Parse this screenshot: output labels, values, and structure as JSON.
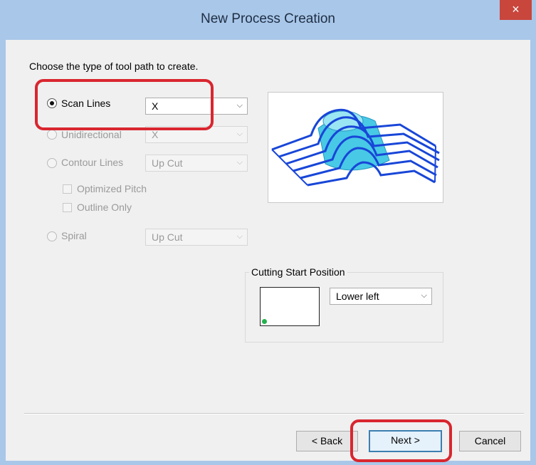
{
  "window": {
    "title": "New Process Creation",
    "close_glyph": "×"
  },
  "instruction": "Choose the type of tool path to create.",
  "options": {
    "scan_lines": {
      "label": "Scan Lines",
      "selected": true,
      "combo_value": "X"
    },
    "unidirectional": {
      "label": "Unidirectional",
      "selected": false,
      "combo_value": "X"
    },
    "contour_lines": {
      "label": "Contour Lines",
      "selected": false,
      "combo_value": "Up Cut"
    },
    "optimized_pitch": {
      "label": "Optimized Pitch",
      "checked": false
    },
    "outline_only": {
      "label": "Outline Only",
      "checked": false
    },
    "spiral": {
      "label": "Spiral",
      "selected": false,
      "combo_value": "Up Cut"
    }
  },
  "cutting_start": {
    "group_label": "Cutting Start Position",
    "combo_value": "Lower left"
  },
  "buttons": {
    "back": "< Back",
    "next": "Next >",
    "cancel": "Cancel"
  },
  "colors": {
    "accent": "#3c7fb1",
    "highlight": "#d9262f",
    "toolpath": "#1846d8",
    "surface": "#48c9e6",
    "start_dot": "#22b14c"
  },
  "icons": {
    "dropdown": "chevron-down-icon",
    "close": "close-icon"
  }
}
